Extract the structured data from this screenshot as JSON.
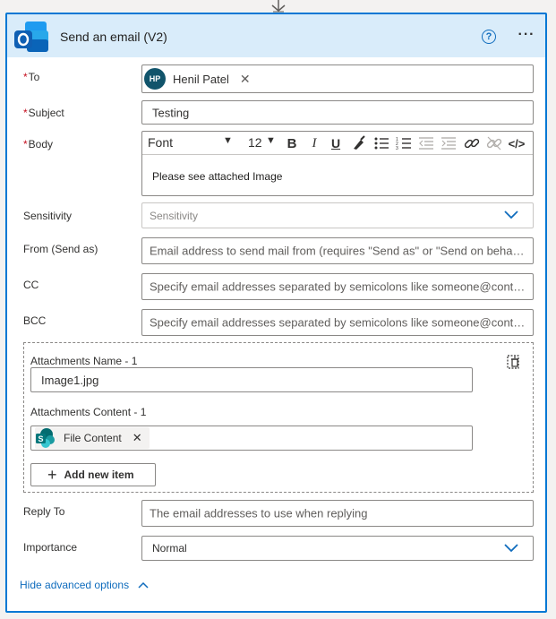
{
  "card": {
    "title": "Send an email (V2)",
    "help_icon": "question-circle-icon",
    "more_label": "···"
  },
  "fields": {
    "to": {
      "label": "To",
      "required": true,
      "recipient": {
        "initials": "HP",
        "name": "Henil Patel",
        "avatar_color": "#11546b"
      }
    },
    "subject": {
      "label": "Subject",
      "required": true,
      "value": "Testing"
    },
    "body": {
      "label": "Body",
      "required": true,
      "font": "Font",
      "font_size": "12",
      "toolbar": [
        "bold-icon",
        "italic-icon",
        "underline-icon",
        "highlight-icon",
        "bullet-list-icon",
        "numbered-list-icon",
        "decrease-indent-icon",
        "increase-indent-icon",
        "link-icon",
        "unlink-icon",
        "code-view-icon"
      ],
      "bold_glyph": "B",
      "italic_glyph": "I",
      "underline_glyph": "U",
      "code_glyph": "</>",
      "value": "Please see attached Image"
    },
    "sensitivity": {
      "label": "Sensitivity",
      "placeholder": "Sensitivity"
    },
    "from": {
      "label": "From (Send as)",
      "placeholder": "Email address to send mail from (requires \"Send as\" or \"Send on behalf of\" permission)"
    },
    "cc": {
      "label": "CC",
      "placeholder": "Specify email addresses separated by semicolons like someone@contoso.com"
    },
    "bcc": {
      "label": "BCC",
      "placeholder": "Specify email addresses separated by semicolons like someone@contoso.com"
    },
    "attachments": {
      "name_label": "Attachments Name - 1",
      "name_value": "Image1.jpg",
      "content_label": "Attachments Content - 1",
      "content_chip": "File Content",
      "add_label": "Add new item"
    },
    "reply_to": {
      "label": "Reply To",
      "placeholder": "The email addresses to use when replying"
    },
    "importance": {
      "label": "Importance",
      "value": "Normal"
    }
  },
  "footer": {
    "hide_advanced_label": "Hide advanced options"
  },
  "colors": {
    "accent": "#0078d4",
    "header_bg": "#d9ecfa",
    "required": "#c50f1f",
    "link": "#0f6cbd"
  }
}
